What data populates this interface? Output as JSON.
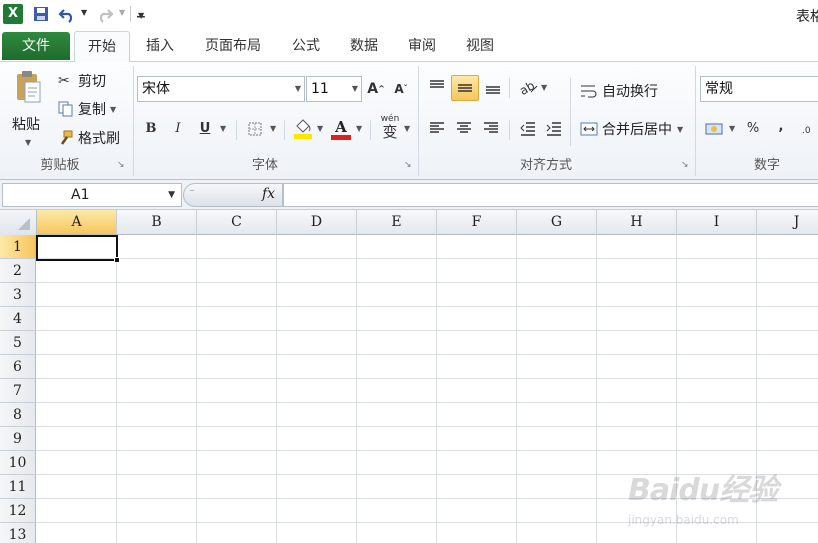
{
  "titlebar": {
    "title_fragment": "表格"
  },
  "tabs": [
    {
      "label": "文件"
    },
    {
      "label": "开始"
    },
    {
      "label": "插入"
    },
    {
      "label": "页面布局"
    },
    {
      "label": "公式"
    },
    {
      "label": "数据"
    },
    {
      "label": "审阅"
    },
    {
      "label": "视图"
    }
  ],
  "clipboard": {
    "paste_label": "粘贴",
    "cut_label": "剪切",
    "copy_label": "复制",
    "format_painter_label": "格式刷",
    "group_label": "剪贴板"
  },
  "font": {
    "font_name": "宋体",
    "font_size": "11",
    "bold": "B",
    "italic": "I",
    "underline": "U",
    "font_color_letter": "A",
    "phonetic_label": "变",
    "phonetic_top": "wén",
    "group_label": "字体"
  },
  "alignment": {
    "wrap_text_label": "自动换行",
    "merge_center_label": "合并后居中",
    "group_label": "对齐方式"
  },
  "number": {
    "format_value": "常规",
    "percent": "%",
    "comma": ",",
    "group_label": "数字"
  },
  "formula_bar": {
    "name_box_value": "A1",
    "fx_label": "fx",
    "formula_value": ""
  },
  "sheet": {
    "columns": [
      "A",
      "B",
      "C",
      "D",
      "E",
      "F",
      "G",
      "H",
      "I",
      "J"
    ],
    "rows": [
      "1",
      "2",
      "3",
      "4",
      "5",
      "6",
      "7",
      "8",
      "9",
      "10",
      "11",
      "12",
      "13"
    ],
    "selected_cell": "A1"
  },
  "watermark": {
    "text": "Baidu经验",
    "url_text": "jingyan.baidu.com"
  },
  "colors": {
    "file_tab": "#1f6b2c",
    "accent_highlight": "#f6c65b",
    "font_color_red": "#e02020",
    "fill_yellow": "#ffe600"
  }
}
